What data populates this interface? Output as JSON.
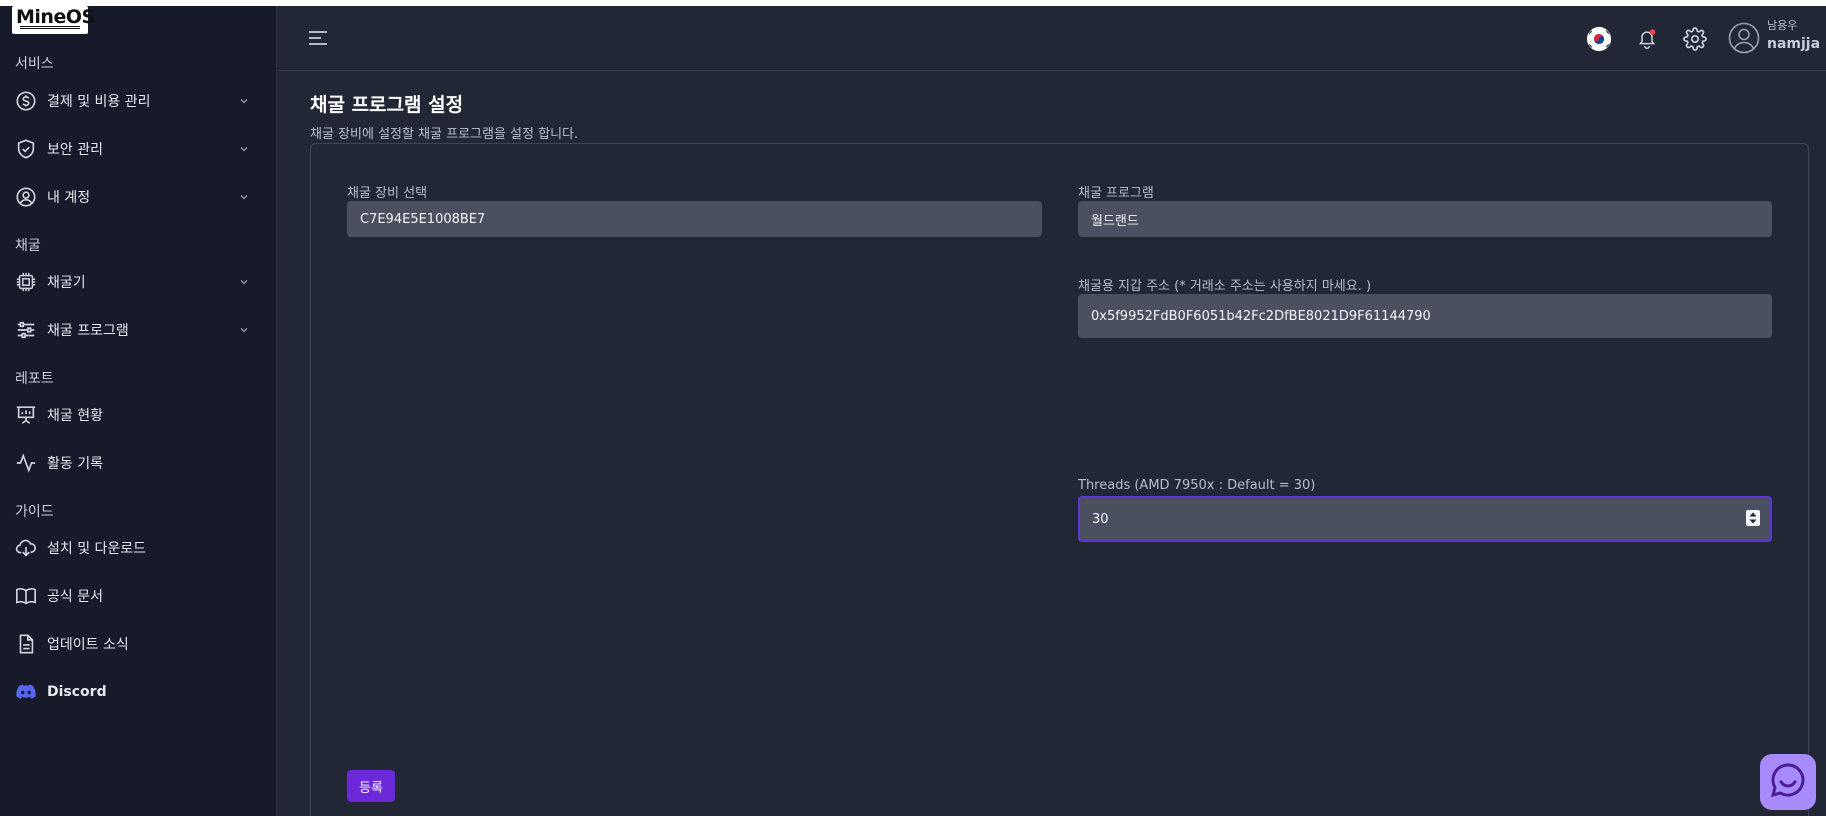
{
  "brand": {
    "logo_text": "MineOS"
  },
  "sidebar": {
    "sections": [
      {
        "title": "서비스"
      },
      {
        "title": "채굴"
      },
      {
        "title": "레포트"
      },
      {
        "title": "가이드"
      }
    ],
    "items": [
      {
        "label": "결제 및 비용 관리",
        "icon": "dollar-icon",
        "has_submenu": true
      },
      {
        "label": "보안 관리",
        "icon": "shield-icon",
        "has_submenu": true
      },
      {
        "label": "내 계정",
        "icon": "user-circle-icon",
        "has_submenu": true
      },
      {
        "label": "채굴기",
        "icon": "cpu-icon",
        "has_submenu": true
      },
      {
        "label": "채굴 프로그램",
        "icon": "sliders-icon",
        "has_submenu": true
      },
      {
        "label": "채굴 현황",
        "icon": "presentation-chart-icon",
        "has_submenu": false
      },
      {
        "label": "활동 기록",
        "icon": "activity-icon",
        "has_submenu": false
      },
      {
        "label": "설치 및 다운로드",
        "icon": "cloud-download-icon",
        "has_submenu": false
      },
      {
        "label": "공식 문서",
        "icon": "book-icon",
        "has_submenu": false
      },
      {
        "label": "업데이트 소식",
        "icon": "document-icon",
        "has_submenu": false
      },
      {
        "label": "Discord",
        "icon": "discord-icon",
        "has_submenu": false
      }
    ]
  },
  "header": {
    "user": {
      "display_name": "남용우",
      "username": "namjja"
    },
    "icons": [
      "menu-icon",
      "korea-flag-icon",
      "bell-icon",
      "gear-icon",
      "avatar-icon"
    ],
    "notification_dot_color": "#ef4444"
  },
  "page": {
    "title": "채굴 프로그램 설정",
    "description": "채굴 장비에 설정할 채굴 프로그램을 설정 합니다."
  },
  "form": {
    "device": {
      "label": "채굴 장비 선택",
      "value": "C7E94E5E1008BE7"
    },
    "program": {
      "label": "채굴 프로그램",
      "value": "월드랜드"
    },
    "wallet": {
      "label": "채굴용 지갑 주소 (* 거래소 주소는 사용하지 마세요. )",
      "value": "0x5f9952FdB0F6051b42Fc2DfBE8021D9F61144790"
    },
    "threads": {
      "label": "Threads (AMD 7950x : Default = 30)",
      "value": "30"
    },
    "submit_label": "등록"
  },
  "colors": {
    "accent": "#6d28d9",
    "sidebar_bg": "#161a2b",
    "main_bg": "#222736",
    "input_bg": "#4b5060",
    "discord": "#5865f2",
    "chat_fab": "#a78bfa"
  }
}
